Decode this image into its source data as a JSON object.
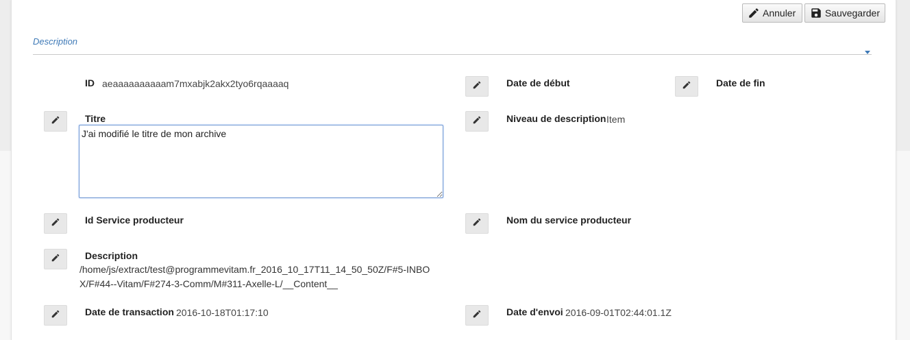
{
  "toolbar": {
    "cancel_label": "Annuler",
    "save_label": "Sauvegarder"
  },
  "section": {
    "title": "Description"
  },
  "fields": {
    "id": {
      "label": "ID",
      "value": "aeaaaaaaaaaam7mxabjk2akx2tyo6rqaaaaq"
    },
    "start_date": {
      "label": "Date de début"
    },
    "end_date": {
      "label": "Date de fin"
    },
    "title": {
      "label": "Titre",
      "value": "J'ai modifié le titre de mon archive"
    },
    "level": {
      "label": "Niveau de description",
      "value": "Item"
    },
    "producer_id": {
      "label": "Id Service producteur"
    },
    "producer_name": {
      "label": "Nom du service producteur"
    },
    "description": {
      "label": "Description",
      "value": "/home/js/extract/test@programmevitam.fr_2016_10_17T11_14_50_50Z/F#5-INBOX/F#44--Vitam/F#274-3-Comm/M#311-Axelle-L/__Content__"
    },
    "transaction_date": {
      "label": "Date de transaction",
      "value": "2016-10-18T01:17:10"
    },
    "sent_date": {
      "label": "Date d'envoi",
      "value": "2016-09-01T02:44:01.1Z"
    }
  },
  "icons": {
    "edit": "pencil-icon",
    "save": "floppy-disk-icon",
    "collapse": "caret-down-icon"
  },
  "colors": {
    "section_title": "#3f7ab7",
    "textarea_focus_border": "#6f97d2"
  }
}
